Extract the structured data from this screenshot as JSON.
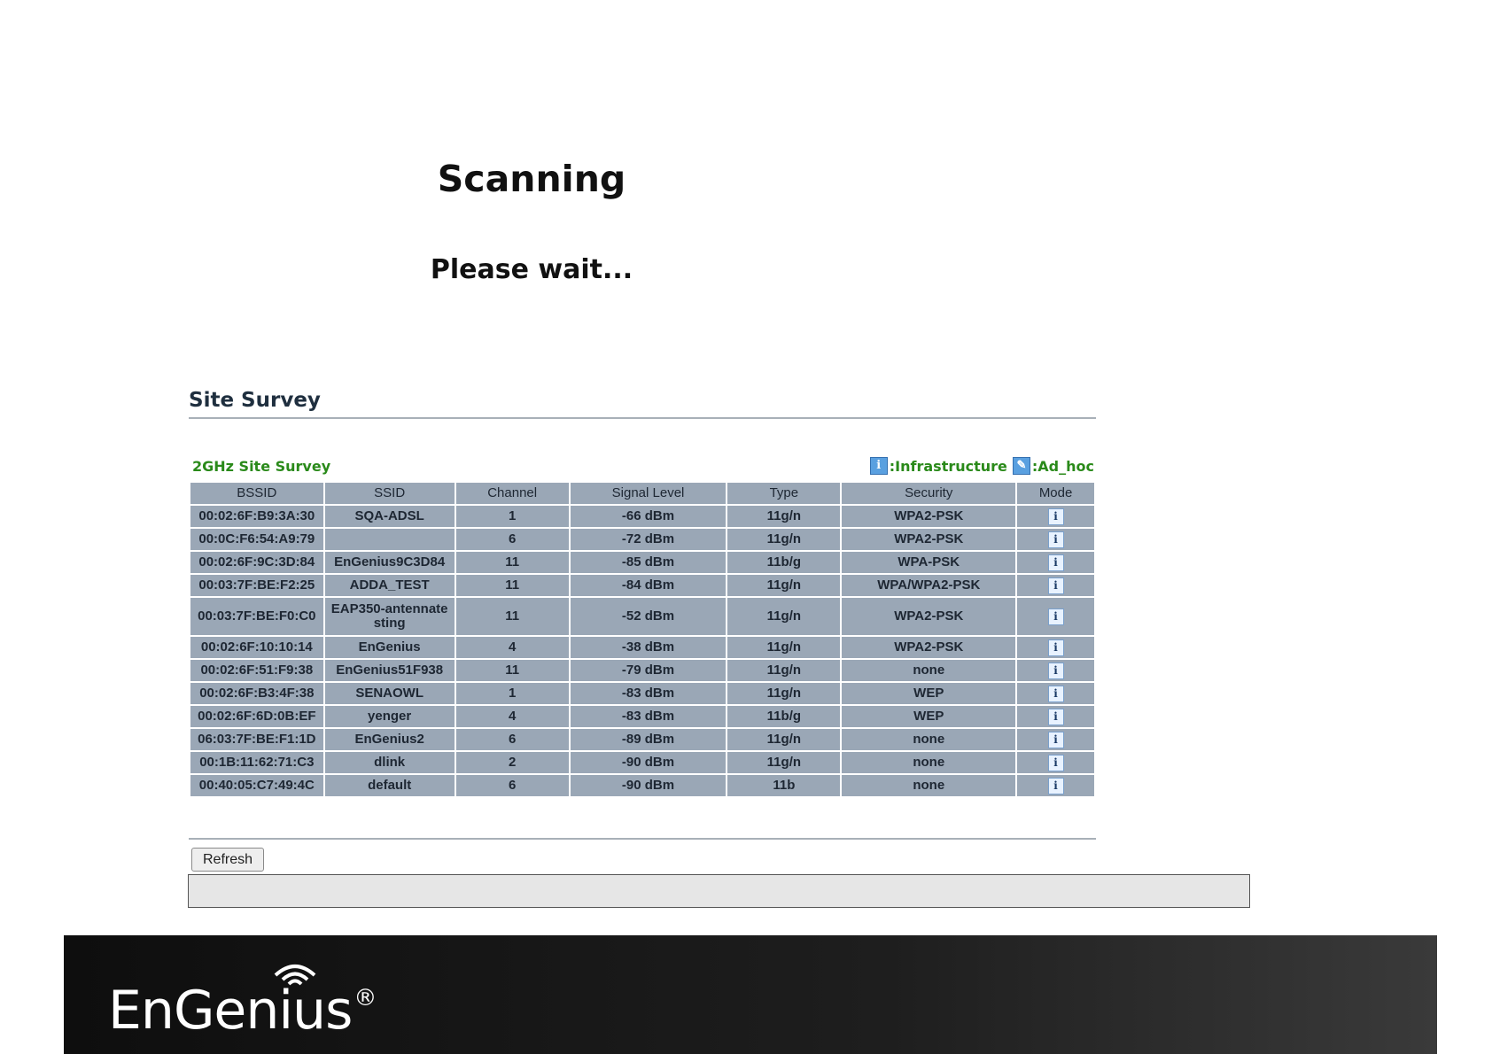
{
  "scanning": {
    "title": "Scanning",
    "subtitle": "Please wait..."
  },
  "survey": {
    "title": "Site Survey",
    "band_label": "2GHz Site Survey",
    "legend": {
      "infrastructure_icon": "info-icon",
      "infrastructure_label": ":Infrastructure",
      "adhoc_icon": "adhoc-icon",
      "adhoc_label": ":Ad_hoc"
    },
    "columns": [
      "BSSID",
      "SSID",
      "Channel",
      "Signal Level",
      "Type",
      "Security",
      "Mode"
    ],
    "rows": [
      {
        "bssid": "00:02:6F:B9:3A:30",
        "ssid": "SQA-ADSL",
        "channel": "1",
        "signal": "-66 dBm",
        "type": "11g/n",
        "security": "WPA2-PSK",
        "mode": "infrastructure"
      },
      {
        "bssid": "00:0C:F6:54:A9:79",
        "ssid": "",
        "channel": "6",
        "signal": "-72 dBm",
        "type": "11g/n",
        "security": "WPA2-PSK",
        "mode": "infrastructure"
      },
      {
        "bssid": "00:02:6F:9C:3D:84",
        "ssid": "EnGenius9C3D84",
        "channel": "11",
        "signal": "-85 dBm",
        "type": "11b/g",
        "security": "WPA-PSK",
        "mode": "infrastructure"
      },
      {
        "bssid": "00:03:7F:BE:F2:25",
        "ssid": "ADDA_TEST",
        "channel": "11",
        "signal": "-84 dBm",
        "type": "11g/n",
        "security": "WPA/WPA2-PSK",
        "mode": "infrastructure"
      },
      {
        "bssid": "00:03:7F:BE:F0:C0",
        "ssid": "EAP350-antennatesting",
        "channel": "11",
        "signal": "-52 dBm",
        "type": "11g/n",
        "security": "WPA2-PSK",
        "mode": "infrastructure"
      },
      {
        "bssid": "00:02:6F:10:10:14",
        "ssid": "EnGenius",
        "channel": "4",
        "signal": "-38 dBm",
        "type": "11g/n",
        "security": "WPA2-PSK",
        "mode": "infrastructure"
      },
      {
        "bssid": "00:02:6F:51:F9:38",
        "ssid": "EnGenius51F938",
        "channel": "11",
        "signal": "-79 dBm",
        "type": "11g/n",
        "security": "none",
        "mode": "infrastructure"
      },
      {
        "bssid": "00:02:6F:B3:4F:38",
        "ssid": "SENAOWL",
        "channel": "1",
        "signal": "-83 dBm",
        "type": "11g/n",
        "security": "WEP",
        "mode": "infrastructure"
      },
      {
        "bssid": "00:02:6F:6D:0B:EF",
        "ssid": "yenger",
        "channel": "4",
        "signal": "-83 dBm",
        "type": "11b/g",
        "security": "WEP",
        "mode": "infrastructure"
      },
      {
        "bssid": "06:03:7F:BE:F1:1D",
        "ssid": "EnGenius2",
        "channel": "6",
        "signal": "-89 dBm",
        "type": "11g/n",
        "security": "none",
        "mode": "infrastructure"
      },
      {
        "bssid": "00:1B:11:62:71:C3",
        "ssid": "dlink",
        "channel": "2",
        "signal": "-90 dBm",
        "type": "11g/n",
        "security": "none",
        "mode": "infrastructure"
      },
      {
        "bssid": "00:40:05:C7:49:4C",
        "ssid": "default",
        "channel": "6",
        "signal": "-90 dBm",
        "type": "11b",
        "security": "none",
        "mode": "infrastructure"
      }
    ],
    "mode_icon": "i"
  },
  "actions": {
    "refresh_label": "Refresh"
  },
  "footer": {
    "logo_text": "EnGenius",
    "logo_mark": "®"
  },
  "colors": {
    "table_cell": "#9aa7b6",
    "band_label": "#2a8a1a",
    "footer_bg": "#1a1a1a"
  }
}
